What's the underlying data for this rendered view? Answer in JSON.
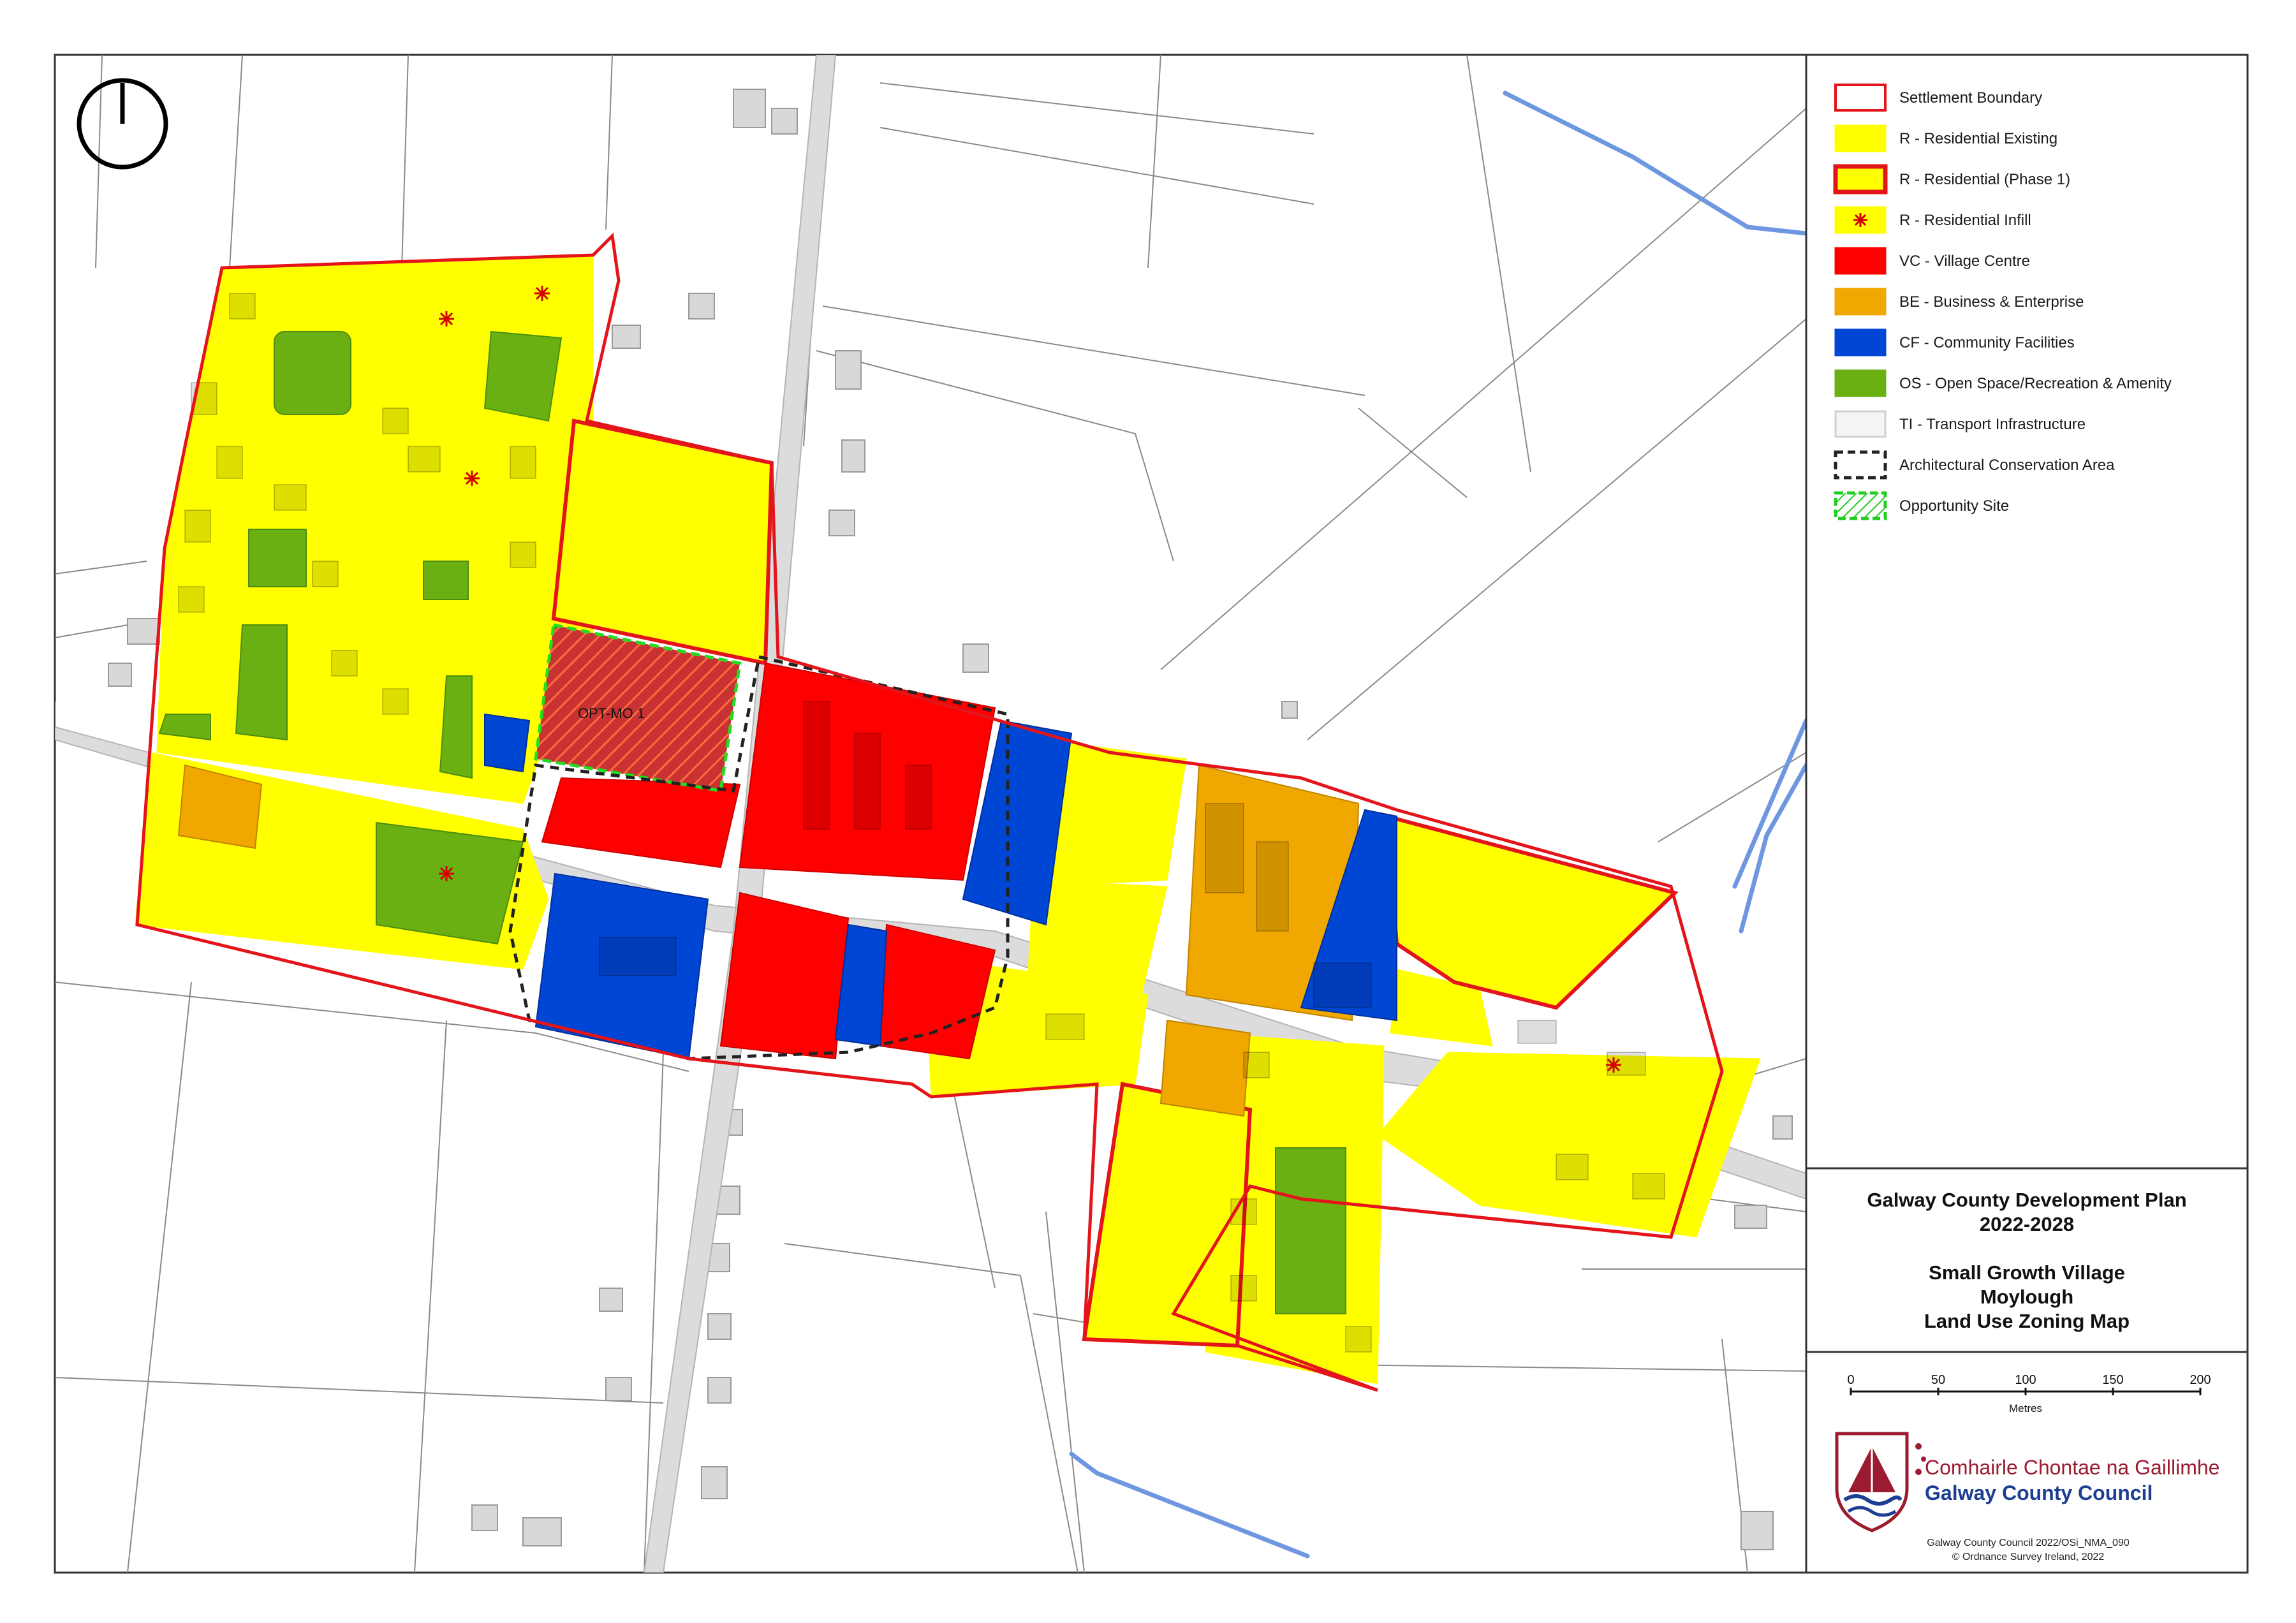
{
  "legend": {
    "items": [
      {
        "label": "Settlement Boundary",
        "fill": "#ffffff",
        "stroke": "#e4141b",
        "pattern": "none"
      },
      {
        "label": "R - Residential Existing",
        "fill": "#ffff00",
        "stroke": "#ffff00",
        "pattern": "none"
      },
      {
        "label": "R - Residential (Phase 1)",
        "fill": "#ffff00",
        "stroke": "#e4141b",
        "pattern": "none"
      },
      {
        "label": "R - Residential Infill",
        "fill": "#ffff00",
        "stroke": "#ffff00",
        "pattern": "asterisk"
      },
      {
        "label": "VC - Village Centre",
        "fill": "#ff0000",
        "stroke": "#ff0000",
        "pattern": "none"
      },
      {
        "label": "BE - Business & Enterprise",
        "fill": "#f0a800",
        "stroke": "#f0a800",
        "pattern": "none"
      },
      {
        "label": "CF - Community Facilities",
        "fill": "#0046d4",
        "stroke": "#0046d4",
        "pattern": "none"
      },
      {
        "label": "OS - Open Space/Recreation & Amenity",
        "fill": "#6ab013",
        "stroke": "#6ab013",
        "pattern": "none"
      },
      {
        "label": "TI - Transport Infrastructure",
        "fill": "#f4f4f4",
        "stroke": "#d0d0d0",
        "pattern": "none"
      },
      {
        "label": "Architectural Conservation Area",
        "fill": "#ffffff",
        "stroke": "#222222",
        "pattern": "dashed"
      },
      {
        "label": "Opportunity Site",
        "fill": "#ffffff",
        "stroke": "#22cc22",
        "pattern": "hatch"
      }
    ]
  },
  "title_block": {
    "plan_line1": "Galway County Development Plan",
    "plan_line2": "2022-2028",
    "map_line1": "Small Growth Village",
    "map_line2": "Moylough",
    "map_line3": "Land Use Zoning Map"
  },
  "scale_bar": {
    "ticks": [
      "0",
      "50",
      "100",
      "150",
      "200"
    ],
    "unit": "Metres"
  },
  "council": {
    "name_irish": "Comhairle Chontae na Gaillimhe",
    "name_english": "Galway County Council",
    "irish_color": "#9b1b30",
    "english_color": "#1c3f94"
  },
  "credits": {
    "line1": "Galway County Council 2022/OSi_NMA_090",
    "line2": "© Ordnance Survey Ireland, 2022"
  },
  "map": {
    "opportunity_site_label": "OPT-MO 1",
    "colors": {
      "residential": "#ffff00",
      "village_centre": "#ff0000",
      "business": "#f0a800",
      "community": "#0046d4",
      "open_space": "#6ab013",
      "boundary": "#e4141b",
      "water": "#6f97e0",
      "road": "#dcdcdc"
    },
    "north_arrow_icon": "north-arrow-icon"
  }
}
